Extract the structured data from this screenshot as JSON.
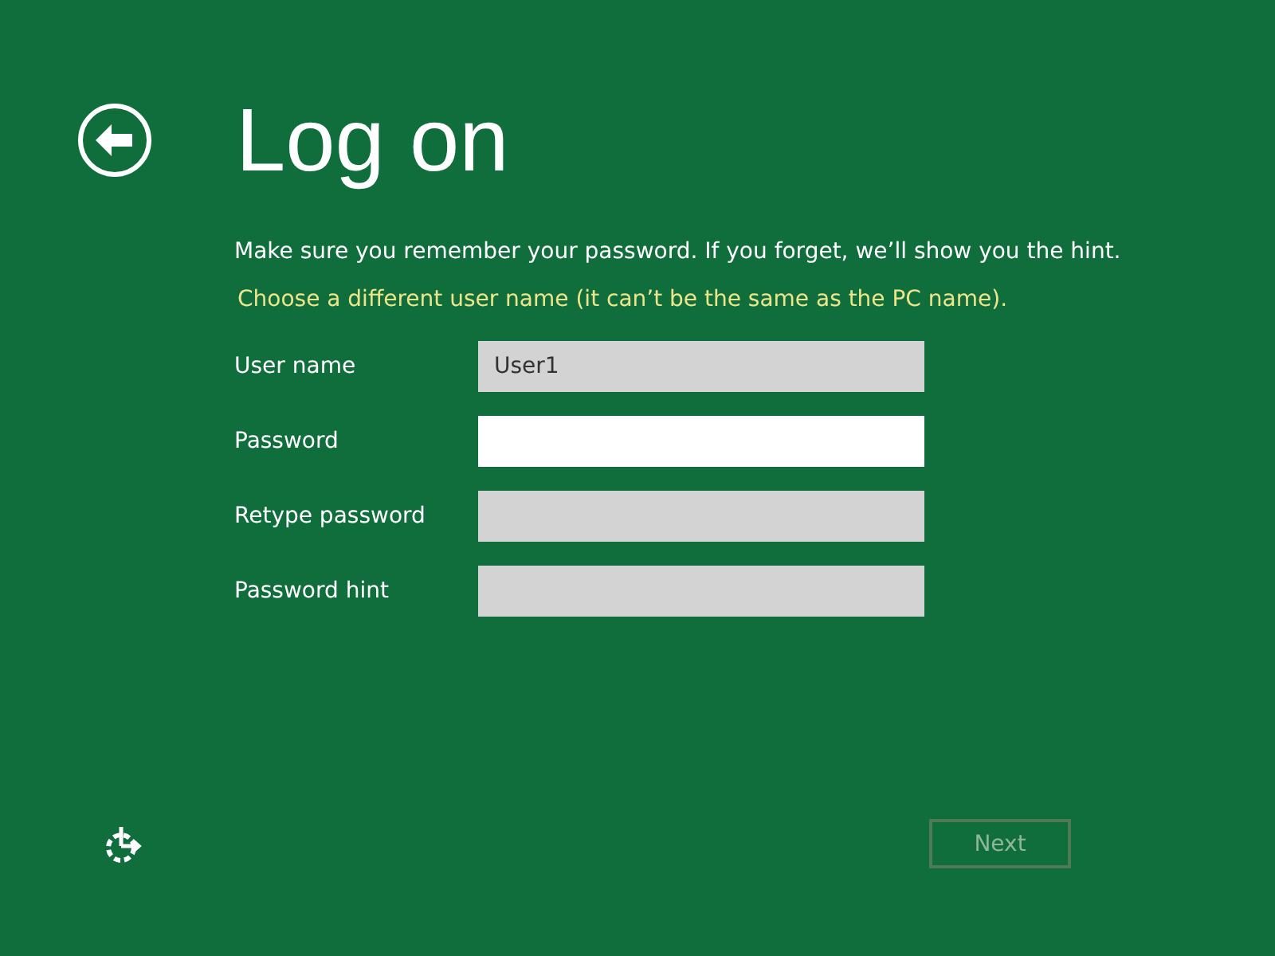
{
  "title": "Log on",
  "message": "Make sure you remember your password. If you forget, we’ll show you the hint.",
  "warning": "Choose a different user name (it can’t be the same as the PC name).",
  "fields": [
    {
      "label": "User name",
      "value": "User1",
      "focused": false
    },
    {
      "label": "Password",
      "focused": true
    },
    {
      "label": "Retype password",
      "focused": false
    },
    {
      "label": "Password hint",
      "focused": false
    }
  ],
  "next_button": {
    "label": "Next",
    "disabled": true
  }
}
